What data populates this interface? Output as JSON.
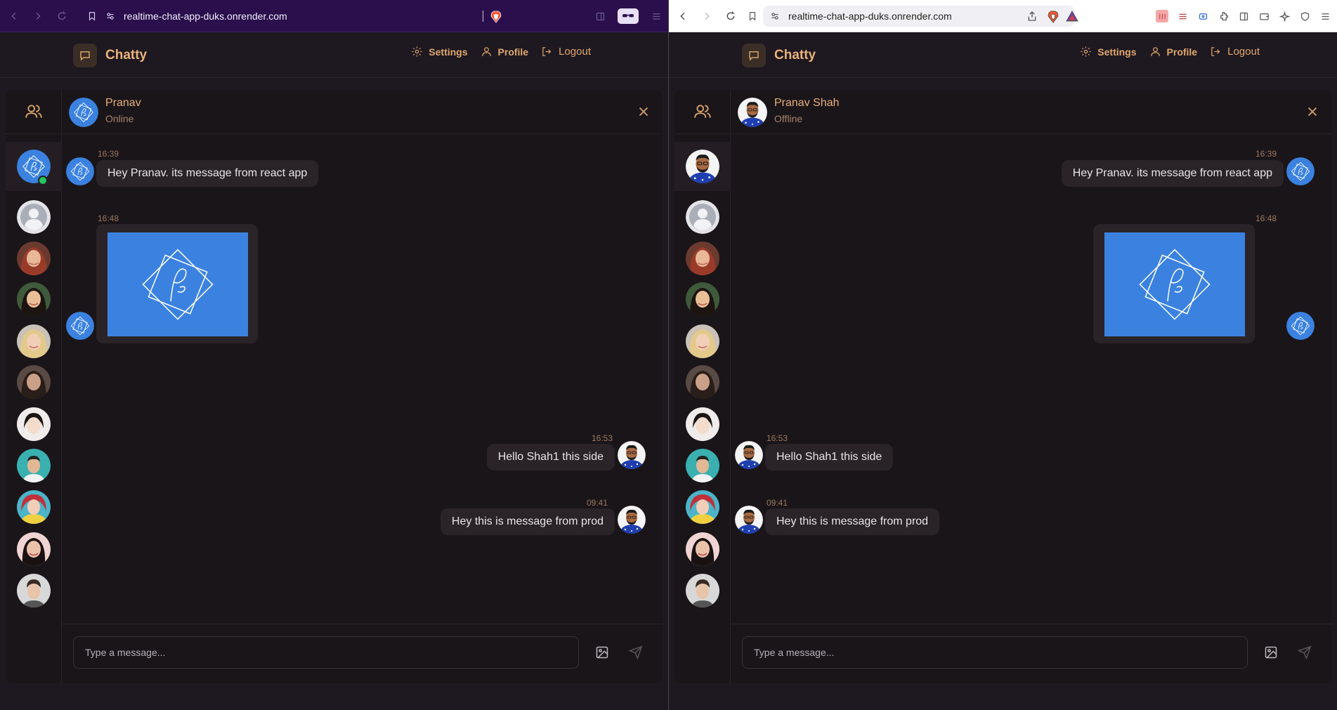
{
  "browser": {
    "url": "realtime-chat-app-duks.onrender.com"
  },
  "app": {
    "name": "Chatty",
    "nav": {
      "settings": "Settings",
      "profile": "Profile",
      "logout": "Logout"
    },
    "input_placeholder": "Type a message..."
  },
  "left": {
    "chat_user": {
      "name": "Pranav",
      "status": "Online"
    },
    "messages": [
      {
        "time": "16:39",
        "text": "Hey Pranav. its message from react app"
      },
      {
        "time": "16:48",
        "text": ""
      },
      {
        "time": "16:53",
        "text": "Hello Shah1 this side"
      },
      {
        "time": "09:41",
        "text": "Hey this is message from prod"
      }
    ]
  },
  "right": {
    "chat_user": {
      "name": "Pranav Shah",
      "status": "Offline"
    },
    "messages": [
      {
        "time": "16:39",
        "text": "Hey Pranav. its message from react app"
      },
      {
        "time": "16:48",
        "text": ""
      },
      {
        "time": "16:53",
        "text": "Hello Shah1 this side"
      },
      {
        "time": "09:41",
        "text": "Hey this is message from prod"
      }
    ]
  },
  "colors": {
    "accent": "#e8b07a",
    "app_bg": "#1a1519",
    "bubble": "#2a2428",
    "online": "#22c55e",
    "image_blue": "#3b82e0",
    "brave_chrome": "#2a0f4c"
  }
}
